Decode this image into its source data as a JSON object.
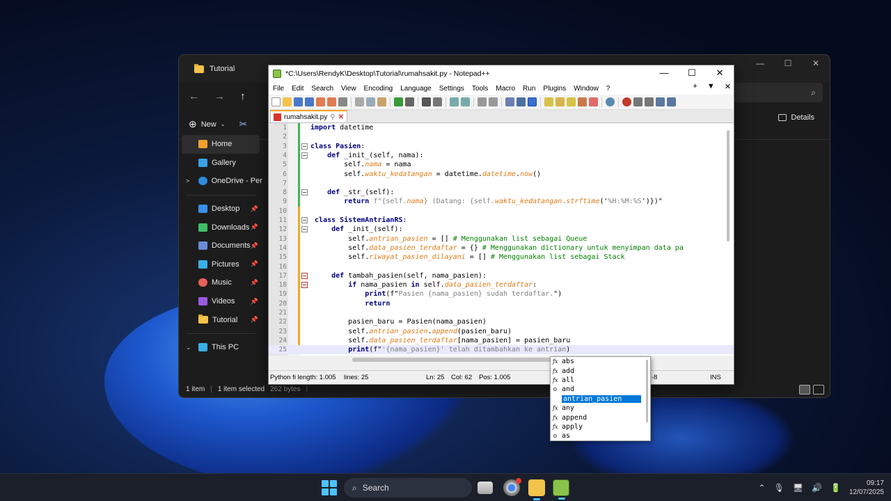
{
  "explorer": {
    "tab_title": "Tutorial",
    "new_label": "New",
    "details_label": "Details",
    "sidebar": [
      {
        "label": "Home",
        "icon": "home-icon",
        "color": "#f0a030",
        "active": true,
        "pin": false
      },
      {
        "label": "Gallery",
        "icon": "gallery-icon",
        "color": "#3aa0e8",
        "active": false,
        "pin": false
      },
      {
        "label": "OneDrive - Perso",
        "icon": "onedrive-icon",
        "color": "#2f8ae0",
        "active": false,
        "pin": false,
        "chevron": ">"
      }
    ],
    "quick_access": [
      {
        "label": "Desktop",
        "icon": "desktop-icon",
        "color": "#3a8ee8"
      },
      {
        "label": "Downloads",
        "icon": "downloads-icon",
        "color": "#3fbf6a"
      },
      {
        "label": "Documents",
        "icon": "documents-icon",
        "color": "#6a8ad8"
      },
      {
        "label": "Pictures",
        "icon": "pictures-icon",
        "color": "#3ab0e8"
      },
      {
        "label": "Music",
        "icon": "music-icon",
        "color": "#e8605a"
      },
      {
        "label": "Videos",
        "icon": "videos-icon",
        "color": "#9a5ae0"
      },
      {
        "label": "Tutorial",
        "icon": "folder-icon",
        "color": "#f3c34b"
      }
    ],
    "this_pc": "This PC",
    "status": {
      "items": "1 item",
      "selected": "1 item selected",
      "size": "262 bytes"
    }
  },
  "npp": {
    "title": "*C:\\Users\\RendyK\\Desktop\\Tutorial\\rumahsakit.py - Notepad++",
    "menu": [
      "File",
      "Edit",
      "Search",
      "View",
      "Encoding",
      "Language",
      "Settings",
      "Tools",
      "Macro",
      "Run",
      "Plugins",
      "Window",
      "?"
    ],
    "tab": "rumahsakit.py",
    "status": {
      "filetype": "Python fi length: 1.005",
      "lines": "lines: 25",
      "ln": "Ln: 25",
      "col": "Col: 62",
      "pos": "Pos: 1.005",
      "enc": "-8",
      "mode": "INS"
    }
  },
  "code_lines": [
    {
      "n": "1",
      "tokens": [
        [
          "kw",
          "import"
        ],
        [
          "id",
          " datetime"
        ]
      ]
    },
    {
      "n": "2",
      "tokens": []
    },
    {
      "n": "3",
      "fold": true,
      "tokens": [
        [
          "kw",
          "class"
        ],
        [
          "id",
          " "
        ],
        [
          "kw",
          "Pasien"
        ],
        [
          "id",
          ":"
        ]
      ]
    },
    {
      "n": "4",
      "fold": true,
      "tokens": [
        [
          "id",
          "    "
        ],
        [
          "kw",
          "def"
        ],
        [
          "id",
          " _init_(self, nama):"
        ]
      ]
    },
    {
      "n": "5",
      "tokens": [
        [
          "id",
          "        self."
        ],
        [
          "attr",
          "nama"
        ],
        [
          "id",
          " = nama"
        ]
      ]
    },
    {
      "n": "6",
      "tokens": [
        [
          "id",
          "        self."
        ],
        [
          "attr",
          "waktu_kedatangan"
        ],
        [
          "id",
          " = datetime."
        ],
        [
          "attr",
          "datetime"
        ],
        [
          "id",
          "."
        ],
        [
          "attr",
          "now"
        ],
        [
          "id",
          "()"
        ]
      ]
    },
    {
      "n": "7",
      "tokens": []
    },
    {
      "n": "8",
      "fold": true,
      "tokens": [
        [
          "id",
          "    "
        ],
        [
          "kw",
          "def"
        ],
        [
          "id",
          " _str_(self):"
        ]
      ]
    },
    {
      "n": "9",
      "tokens": [
        [
          "id",
          "        "
        ],
        [
          "kw",
          "return"
        ],
        [
          "st",
          " f\"{self."
        ],
        [
          "attr",
          "nama"
        ],
        [
          "st",
          "} (Datang: {self."
        ],
        [
          "attr",
          "waktu_kedatangan"
        ],
        [
          "st",
          "."
        ],
        [
          "attr",
          "strftime"
        ],
        [
          "id",
          "('"
        ],
        [
          "st",
          "%H:%M:%S"
        ],
        [
          "id",
          "')})\""
        ]
      ]
    },
    {
      "n": "10",
      "tokens": []
    },
    {
      "n": "11",
      "fold": true,
      "tokens": [
        [
          "id",
          " "
        ],
        [
          "kw",
          "class"
        ],
        [
          "id",
          " "
        ],
        [
          "kw",
          "SistemAntrianRS"
        ],
        [
          "id",
          ":"
        ]
      ]
    },
    {
      "n": "12",
      "fold": true,
      "tokens": [
        [
          "id",
          "     "
        ],
        [
          "kw",
          "def"
        ],
        [
          "id",
          " _init_(self):"
        ]
      ]
    },
    {
      "n": "13",
      "tokens": [
        [
          "id",
          "         self."
        ],
        [
          "attr",
          "antrian_pasien"
        ],
        [
          "id",
          " = [] "
        ],
        [
          "cm",
          "# Menggunakan list sebagai Queue"
        ]
      ]
    },
    {
      "n": "14",
      "tokens": [
        [
          "id",
          "         self."
        ],
        [
          "attr",
          "data_pasien_terdaftar"
        ],
        [
          "id",
          " = {} "
        ],
        [
          "cm",
          "# Menggunakan dictionary untuk menyimpan data pa"
        ]
      ]
    },
    {
      "n": "15",
      "tokens": [
        [
          "id",
          "         self."
        ],
        [
          "attr",
          "riwayat_pasien_dilayani"
        ],
        [
          "id",
          " = [] "
        ],
        [
          "cm",
          "# Menggunakan list sebagai Stack"
        ]
      ]
    },
    {
      "n": "16",
      "tokens": []
    },
    {
      "n": "17",
      "fold": "red",
      "tokens": [
        [
          "id",
          "     "
        ],
        [
          "kw",
          "def"
        ],
        [
          "id",
          " tambah_pasien(self, nama_pasien):"
        ]
      ]
    },
    {
      "n": "18",
      "fold": "red",
      "tokens": [
        [
          "id",
          "         "
        ],
        [
          "kw",
          "if"
        ],
        [
          "id",
          " nama_pasien "
        ],
        [
          "kw",
          "in"
        ],
        [
          "id",
          " self."
        ],
        [
          "attr",
          "data_pasien_terdaftar"
        ],
        [
          "id",
          ":"
        ]
      ]
    },
    {
      "n": "19",
      "tokens": [
        [
          "id",
          "             "
        ],
        [
          "kw",
          "print"
        ],
        [
          "id",
          "(f\""
        ],
        [
          "st",
          "Pasien {nama_pasien} sudah terdaftar."
        ],
        [
          "id",
          "\")"
        ]
      ]
    },
    {
      "n": "20",
      "tokens": [
        [
          "id",
          "             "
        ],
        [
          "kw",
          "return"
        ]
      ]
    },
    {
      "n": "21",
      "tokens": []
    },
    {
      "n": "22",
      "tokens": [
        [
          "id",
          "         pasien_baru = Pasien(nama_pasien)"
        ]
      ]
    },
    {
      "n": "23",
      "tokens": [
        [
          "id",
          "         self."
        ],
        [
          "attr",
          "antrian_pasien"
        ],
        [
          "id",
          "."
        ],
        [
          "attr",
          "append"
        ],
        [
          "id",
          "(pasien_baru)"
        ]
      ]
    },
    {
      "n": "24",
      "tokens": [
        [
          "id",
          "         self."
        ],
        [
          "attr",
          "data_pasien_terdaftar"
        ],
        [
          "id",
          "[nama_pasien] = pasien_baru"
        ]
      ]
    },
    {
      "n": "25",
      "current": true,
      "tokens": [
        [
          "id",
          "         "
        ],
        [
          "kw",
          "print"
        ],
        [
          "id",
          "(f\""
        ],
        [
          "st",
          "'{nama_pasien}' telah ditambahkan ke antrian"
        ],
        [
          "id",
          ")"
        ]
      ]
    }
  ],
  "autocomplete": [
    {
      "label": "abs",
      "icon": "fx"
    },
    {
      "label": "add",
      "icon": "fx"
    },
    {
      "label": "all",
      "icon": "fx"
    },
    {
      "label": "and",
      "icon": "kw"
    },
    {
      "label": "antrian_pasien",
      "icon": "",
      "selected": true
    },
    {
      "label": "any",
      "icon": "fx"
    },
    {
      "label": "append",
      "icon": "fx"
    },
    {
      "label": "apply",
      "icon": "fx"
    },
    {
      "label": "as",
      "icon": "kw"
    }
  ],
  "taskbar": {
    "search": "Search",
    "time": "09:17",
    "date": "12/07/2025"
  }
}
